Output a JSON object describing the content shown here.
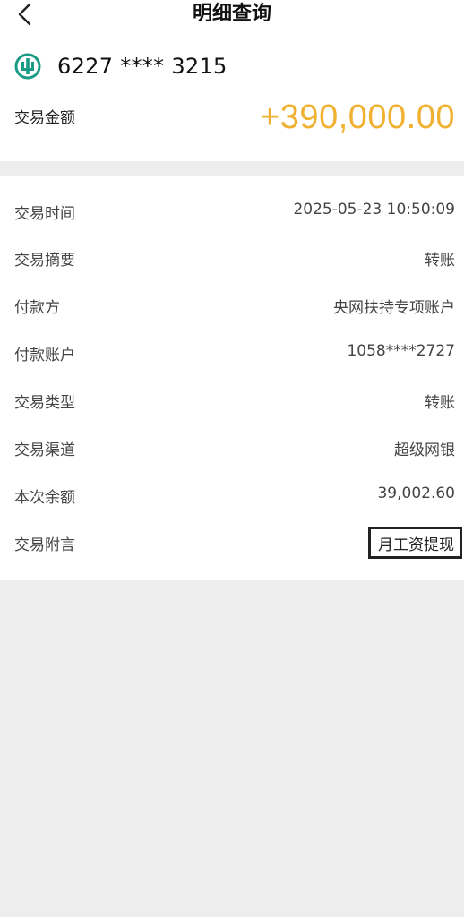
{
  "header": {
    "title": "明细查询"
  },
  "account": {
    "number": "6227 **** 3215"
  },
  "amount": {
    "label": "交易金额",
    "value": "+390,000.00",
    "color": "#f0b030"
  },
  "details": [
    {
      "label": "交易时间",
      "value": "2025-05-23 10:50:09"
    },
    {
      "label": "交易摘要",
      "value": "转账"
    },
    {
      "label": "付款方",
      "value": "央网扶持专项账户"
    },
    {
      "label": "付款账户",
      "value": "1058****2727"
    },
    {
      "label": "交易类型",
      "value": "转账"
    },
    {
      "label": "交易渠道",
      "value": "超级网银"
    },
    {
      "label": "本次余额",
      "value": "39,002.60"
    },
    {
      "label": "交易附言",
      "value": "月工资提现"
    }
  ],
  "icons": {
    "back": "chevron-left-icon",
    "bank_logo": "bank-logo-icon"
  },
  "colors": {
    "background": "#ededed",
    "card": "#ffffff",
    "bank_logo": "#1a9b86"
  }
}
